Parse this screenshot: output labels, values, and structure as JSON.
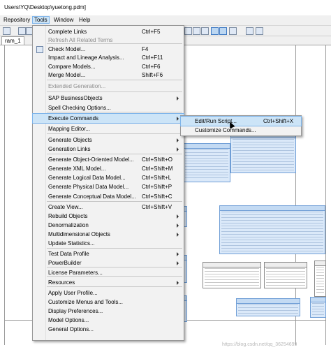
{
  "window": {
    "title": "Users\\YQ\\Desktop\\yuetong.pdm]"
  },
  "menubar": {
    "items": [
      "Repository",
      "Tools",
      "Window",
      "Help"
    ],
    "active": "Tools"
  },
  "diagram_tab": {
    "label": "ram_1"
  },
  "tools_menu": {
    "items": [
      {
        "label": "Complete Links",
        "shortcut": "Ctrl+F5",
        "disabled": false,
        "submenu": false,
        "icon": false
      },
      {
        "label": "Refresh All Related Terms",
        "shortcut": "",
        "disabled": true,
        "submenu": false,
        "icon": false
      },
      {
        "label": "Check Model...",
        "shortcut": "F4",
        "disabled": false,
        "submenu": false,
        "icon": true
      },
      {
        "label": "Impact and Lineage Analysis...",
        "shortcut": "Ctrl+F11",
        "disabled": false,
        "submenu": false,
        "icon": false
      },
      {
        "label": "Compare Models...",
        "shortcut": "Ctrl+F6",
        "disabled": false,
        "submenu": false,
        "icon": false
      },
      {
        "label": "Merge Model...",
        "shortcut": "Shift+F6",
        "disabled": false,
        "submenu": false,
        "icon": false
      },
      {
        "label": "Extended Generation...",
        "shortcut": "",
        "disabled": true,
        "submenu": false,
        "icon": false
      },
      {
        "label": "SAP BusinessObjects",
        "shortcut": "",
        "disabled": false,
        "submenu": true,
        "icon": false
      },
      {
        "label": "Spell Checking Options...",
        "shortcut": "",
        "disabled": false,
        "submenu": false,
        "icon": false
      },
      {
        "label": "Execute Commands",
        "shortcut": "",
        "disabled": false,
        "submenu": true,
        "icon": false,
        "highlighted": true
      },
      {
        "label": "Mapping Editor...",
        "shortcut": "",
        "disabled": false,
        "submenu": false,
        "icon": false
      },
      {
        "label": "Generate Objects",
        "shortcut": "",
        "disabled": false,
        "submenu": true,
        "icon": false
      },
      {
        "label": "Generation Links",
        "shortcut": "",
        "disabled": false,
        "submenu": true,
        "icon": false
      },
      {
        "label": "Generate Object-Oriented Model...",
        "shortcut": "Ctrl+Shift+O",
        "disabled": false,
        "submenu": false,
        "icon": false
      },
      {
        "label": "Generate XML Model...",
        "shortcut": "Ctrl+Shift+M",
        "disabled": false,
        "submenu": false,
        "icon": false
      },
      {
        "label": "Generate Logical Data Model...",
        "shortcut": "Ctrl+Shift+L",
        "disabled": false,
        "submenu": false,
        "icon": false
      },
      {
        "label": "Generate Physical Data Model...",
        "shortcut": "Ctrl+Shift+P",
        "disabled": false,
        "submenu": false,
        "icon": false
      },
      {
        "label": "Generate Conceptual Data Model...",
        "shortcut": "Ctrl+Shift+C",
        "disabled": false,
        "submenu": false,
        "icon": false
      },
      {
        "label": "Create View...",
        "shortcut": "Ctrl+Shift+V",
        "disabled": false,
        "submenu": false,
        "icon": false
      },
      {
        "label": "Rebuild Objects",
        "shortcut": "",
        "disabled": false,
        "submenu": true,
        "icon": false
      },
      {
        "label": "Denormalization",
        "shortcut": "",
        "disabled": false,
        "submenu": true,
        "icon": false
      },
      {
        "label": "Multidimensional Objects",
        "shortcut": "",
        "disabled": false,
        "submenu": true,
        "icon": false
      },
      {
        "label": "Update Statistics...",
        "shortcut": "",
        "disabled": false,
        "submenu": false,
        "icon": false
      },
      {
        "label": "Test Data Profile",
        "shortcut": "",
        "disabled": false,
        "submenu": true,
        "icon": false
      },
      {
        "label": "PowerBuilder",
        "shortcut": "",
        "disabled": false,
        "submenu": true,
        "icon": false
      },
      {
        "label": "License Parameters...",
        "shortcut": "",
        "disabled": false,
        "submenu": false,
        "icon": false
      },
      {
        "label": "Resources",
        "shortcut": "",
        "disabled": false,
        "submenu": true,
        "icon": false
      },
      {
        "label": "Apply User Profile...",
        "shortcut": "",
        "disabled": false,
        "submenu": false,
        "icon": false
      },
      {
        "label": "Customize Menus and Tools...",
        "shortcut": "",
        "disabled": false,
        "submenu": false,
        "icon": false
      },
      {
        "label": "Display Preferences...",
        "shortcut": "",
        "disabled": false,
        "submenu": false,
        "icon": false
      },
      {
        "label": "Model Options...",
        "shortcut": "",
        "disabled": false,
        "submenu": false,
        "icon": false
      },
      {
        "label": "General Options...",
        "shortcut": "",
        "disabled": false,
        "submenu": false,
        "icon": false
      }
    ]
  },
  "execute_submenu": {
    "items": [
      {
        "label": "Edit/Run Script...",
        "shortcut": "Ctrl+Shift+X",
        "highlighted": true
      },
      {
        "label": "Customize Commands...",
        "shortcut": ""
      }
    ]
  },
  "watermark": {
    "text": "https://blog.csdn.net/qq_36254699"
  },
  "colors": {
    "menu_highlight": "#cce4f7",
    "table_fill": "#dbe9f9",
    "table_border": "#6f9ed6"
  }
}
